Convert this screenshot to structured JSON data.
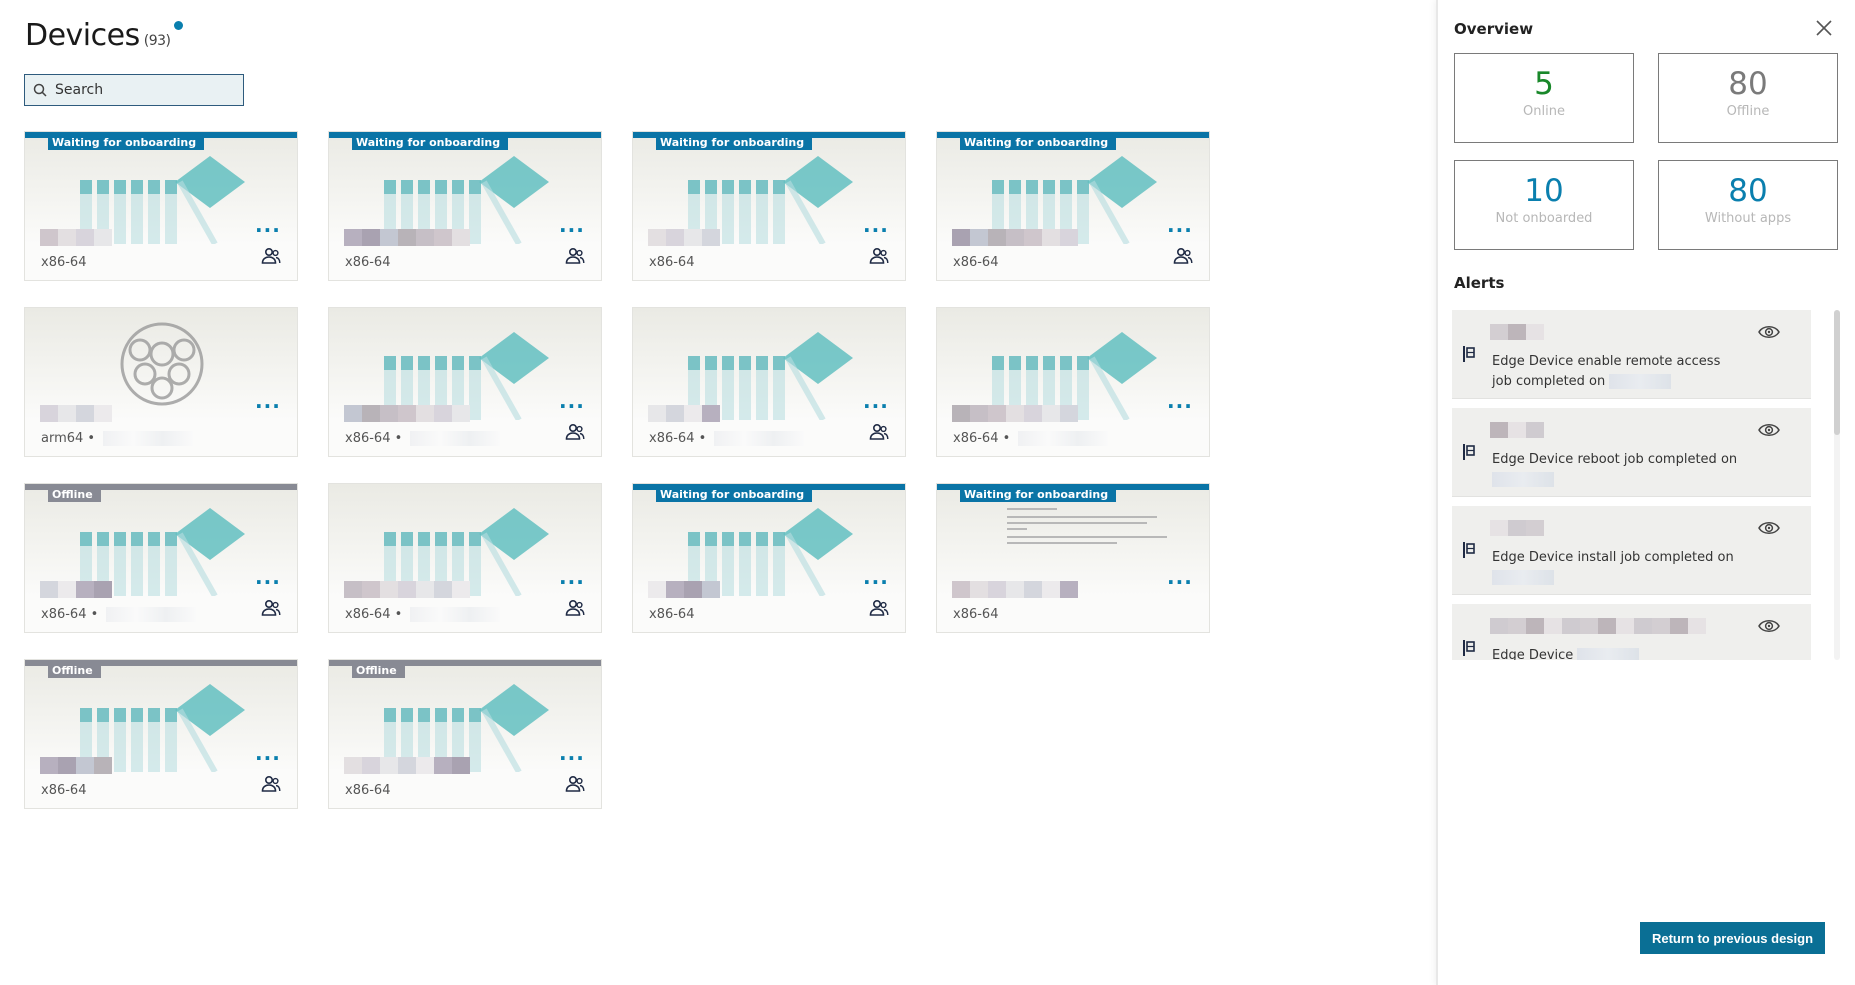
{
  "header": {
    "title": "Devices",
    "count": "(93)"
  },
  "search": {
    "placeholder": "Search"
  },
  "colors": {
    "accent": "#0a7fae",
    "waiting": "#0a74a6",
    "offline": "#888a94",
    "online": "#19882a"
  },
  "devices": [
    {
      "status": "Waiting for onboarding",
      "arch": "x86-64",
      "people": true
    },
    {
      "status": "Waiting for onboarding",
      "arch": "x86-64",
      "people": true
    },
    {
      "status": "Waiting for onboarding",
      "arch": "x86-64",
      "people": true
    },
    {
      "status": "Waiting for onboarding",
      "arch": "x86-64",
      "people": true
    },
    {
      "status": "",
      "arch": "arm64 •",
      "people": false,
      "image": "raspberry-logo"
    },
    {
      "status": "",
      "arch": "x86-64 •",
      "people": true
    },
    {
      "status": "",
      "arch": "x86-64 •",
      "people": true
    },
    {
      "status": "",
      "arch": "x86-64 •",
      "people": false
    },
    {
      "status": "Offline",
      "arch": "x86-64 •",
      "people": true
    },
    {
      "status": "",
      "arch": "x86-64 •",
      "people": true
    },
    {
      "status": "Waiting for onboarding",
      "arch": "x86-64",
      "people": true
    },
    {
      "status": "Waiting for onboarding",
      "arch": "x86-64",
      "people": false,
      "image": "document"
    },
    {
      "status": "Offline",
      "arch": "x86-64",
      "people": true
    },
    {
      "status": "Offline",
      "arch": "x86-64",
      "people": true
    }
  ],
  "card_more_label": "···",
  "overview": {
    "title": "Overview",
    "stats": [
      {
        "value": "5",
        "label": "Online"
      },
      {
        "value": "80",
        "label": "Offline"
      },
      {
        "value": "10",
        "label": "Not onboarded"
      },
      {
        "value": "80",
        "label": "Without apps"
      }
    ]
  },
  "alerts": {
    "title": "Alerts",
    "items": [
      {
        "text": "Edge Device enable remote access job completed on"
      },
      {
        "text": "Edge Device reboot job completed on"
      },
      {
        "text": "Edge Device install job completed on"
      },
      {
        "text": "Edge Device"
      }
    ]
  },
  "return_button": "Return to previous design",
  "icons": {
    "search": "search-icon",
    "close": "close-icon",
    "more": "more-icon",
    "people": "people-icon",
    "flag": "flag-icon",
    "eye": "eye-icon"
  }
}
